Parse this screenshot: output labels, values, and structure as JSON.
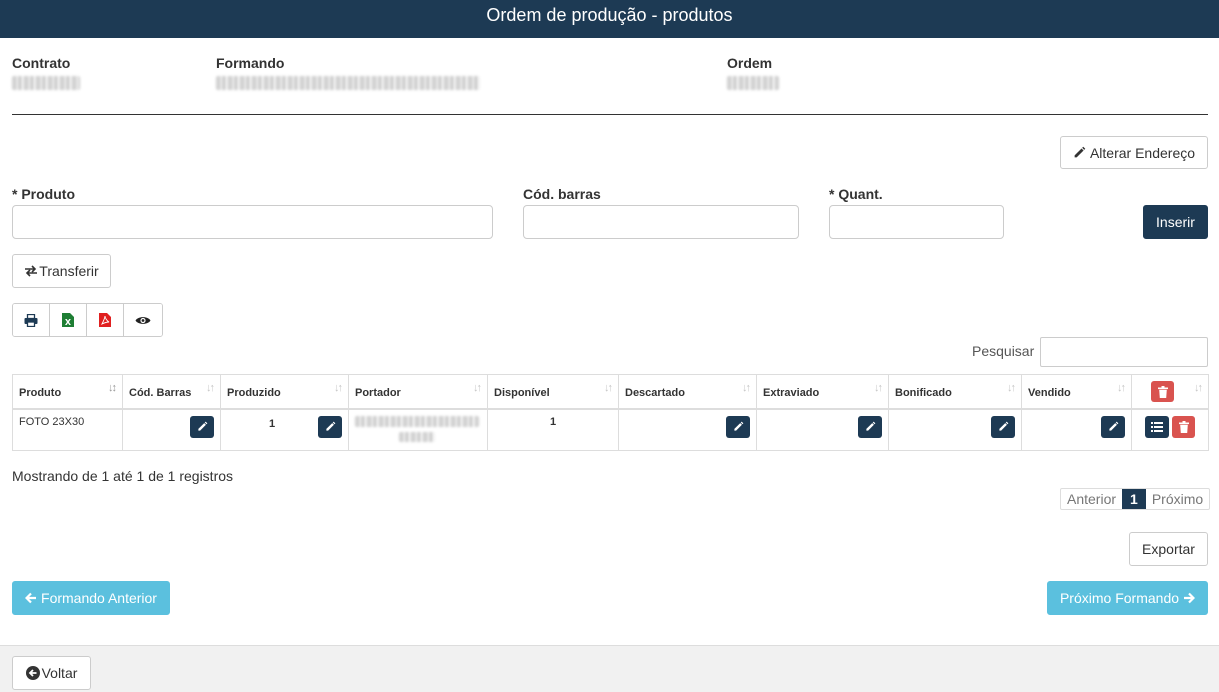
{
  "window": {
    "title": "Ordem de produção - produtos"
  },
  "header_info": {
    "contrato_label": "Contrato",
    "formando_label": "Formando",
    "ordem_label": "Ordem"
  },
  "toolbar": {
    "alterar_endereco_label": "Alterar Endereço",
    "transferir_label": "Transferir",
    "inserir_label": "Inserir"
  },
  "form": {
    "produto_label": "* Produto",
    "cod_barras_label": "Cód. barras",
    "quant_label": "* Quant."
  },
  "export_icons": [
    "print-icon",
    "excel-icon",
    "pdf-icon",
    "eye-icon"
  ],
  "search": {
    "label": "Pesquisar"
  },
  "table": {
    "columns": [
      "Produto",
      "Cód. Barras",
      "Produzido",
      "Portador",
      "Disponível",
      "Descartado",
      "Extraviado",
      "Bonificado",
      "Vendido"
    ],
    "rows": [
      {
        "produto": "FOTO 23X30",
        "produzido": "1",
        "disponivel": "1"
      }
    ]
  },
  "pagination": {
    "summary": "Mostrando de 1 até 1 de 1 registros",
    "prev_label": "Anterior",
    "current_page": "1",
    "next_label": "Próximo"
  },
  "actions": {
    "exportar_label": "Exportar",
    "formando_anterior_label": "Formando Anterior",
    "proximo_formando_label": "Próximo Formando",
    "voltar_label": "Voltar"
  },
  "colors": {
    "primary": "#1d3a54",
    "info": "#5bc0de",
    "danger": "#d9534f",
    "excel": "#1e7e34",
    "pdf": "#e02020"
  }
}
